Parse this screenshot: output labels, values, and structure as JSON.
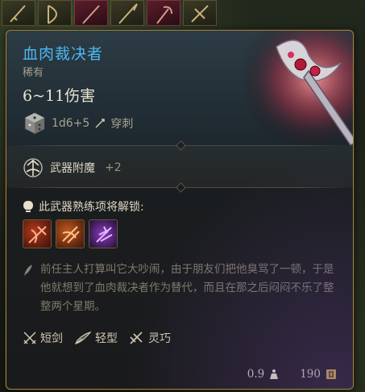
{
  "hotbar": {
    "slots": [
      "sword-hotbar-icon",
      "bow-hotbar-icon",
      "staff-hotbar-icon",
      "spear-hotbar-icon",
      "axe-hotbar-icon",
      "crossbow-hotbar-icon"
    ]
  },
  "item": {
    "name": "血肉裁决者",
    "rarity": "稀有",
    "damage": "6~11伤害",
    "dice": "1d6+5",
    "damage_type": "穿刺",
    "name_color": "#4cb8f2"
  },
  "enchant": {
    "label": "武器附魔",
    "bonus": "+2"
  },
  "unlock": {
    "label": "此武器熟练项将解锁:",
    "actions": [
      "slash-action-icon",
      "flourish-action-icon",
      "lacerate-action-icon"
    ]
  },
  "lore": "前任主人打算叫它大吵闹，由于朋友们把他臭骂了一顿，于是他就想到了血肉裁决者作为替代，而且在那之后闷闷不乐了整整两个星期。",
  "properties": [
    {
      "icon": "crossed-swords-icon",
      "label": "短剑"
    },
    {
      "icon": "feather-icon",
      "label": "轻型"
    },
    {
      "icon": "finesse-icon",
      "label": "灵巧"
    }
  ],
  "footer": {
    "weight": "0.9",
    "value": "190"
  }
}
